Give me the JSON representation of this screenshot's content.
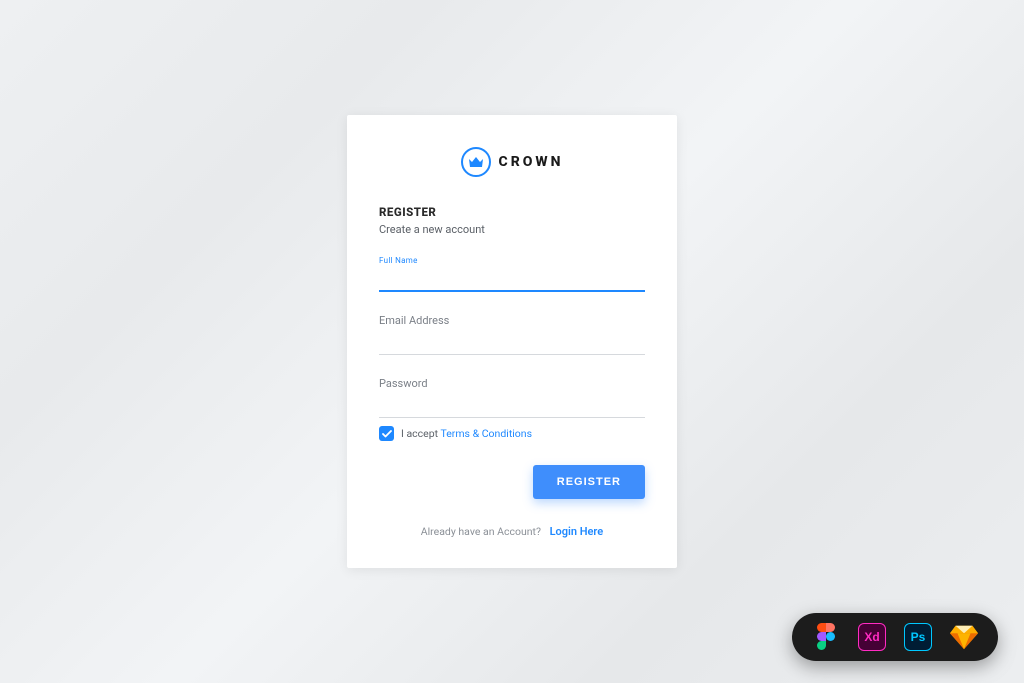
{
  "brand": {
    "name": "CROWN"
  },
  "form": {
    "heading": "REGISTER",
    "subheading": "Create a new account",
    "fields": {
      "fullname": {
        "label": "Full Name",
        "value": ""
      },
      "email": {
        "label": "Email Address",
        "value": ""
      },
      "password": {
        "label": "Password",
        "value": ""
      }
    },
    "terms": {
      "checked": true,
      "prefix": "I accept ",
      "link_text": "Terms & Conditions"
    },
    "submit_label": "REGISTER"
  },
  "footer": {
    "prompt": "Already have an Account?",
    "link_text": "Login Here"
  },
  "toolbar_icons": [
    "figma",
    "adobe-xd",
    "photoshop",
    "sketch"
  ],
  "colors": {
    "accent": "#1e88ff",
    "button": "#3f8efc"
  }
}
